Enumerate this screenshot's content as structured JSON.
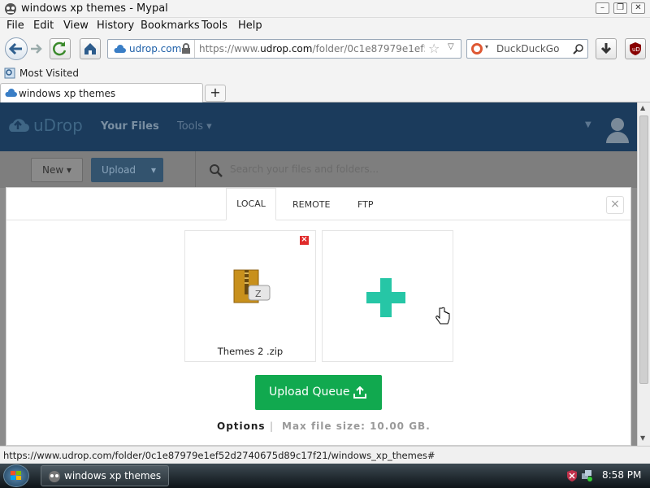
{
  "window": {
    "title": "windows xp themes - Mypal",
    "minimize": "–",
    "restore": "❐",
    "close": "✕"
  },
  "menu": [
    {
      "label": "File"
    },
    {
      "label": "Edit"
    },
    {
      "label": "View"
    },
    {
      "label": "History"
    },
    {
      "label": "Bookmarks"
    },
    {
      "label": "Tools"
    },
    {
      "label": "Help"
    }
  ],
  "nav": {
    "identity_label": "udrop.com",
    "url_prefix": "https://www.",
    "url_domain": "udrop.com",
    "url_path": "/folder/0c1e87979e1ef52d27",
    "search_placeholder": "DuckDuckGo"
  },
  "bookmarks": {
    "most_visited": "Most Visited"
  },
  "tab": {
    "title": "windows xp themes",
    "new_tab": "+"
  },
  "site": {
    "logo_text": "uDrop",
    "your_files": "Your Files",
    "tools": "Tools",
    "new_button": "New",
    "upload_button": "Upload",
    "search_placeholder": "Search your files and folders..."
  },
  "modal": {
    "tabs": [
      {
        "label": "LOCAL"
      },
      {
        "label": "REMOTE"
      },
      {
        "label": "FTP"
      }
    ],
    "close": "×",
    "file": {
      "name": "Themes 2 .zip",
      "remove": "×"
    },
    "upload_queue": "Upload Queue",
    "options": "Options",
    "separator": "|",
    "max_size": "Max file size: 10.00 GB."
  },
  "status_url": "https://www.udrop.com/folder/0c1e87979e1ef52d2740675d89c17f21/windows_xp_themes#",
  "taskbar": {
    "task": "windows xp themes ...",
    "clock": "8:58 PM"
  },
  "colors": {
    "header_bg": "#1b3b5c",
    "upload_btn": "#1f60ad",
    "queue_btn": "#11a94f",
    "plus": "#26c6a6",
    "remove": "#e02b2b"
  }
}
